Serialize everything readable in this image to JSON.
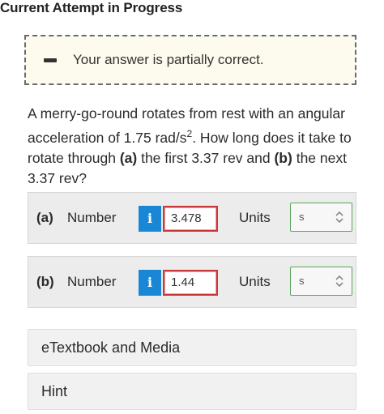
{
  "header": {
    "title": "Current Attempt in Progress"
  },
  "notice": {
    "icon": "minus-icon",
    "message": "Your answer is partially correct."
  },
  "question": {
    "line1": "A merry-go-round rotates from rest with an angular",
    "line2_pre": "acceleration of 1.75 rad/s",
    "line2_sup": "2",
    "line2_post": ". How long does it take to",
    "line3_pre": "rotate through ",
    "line3_a": "(a)",
    "line3_mid": " the first 3.37 rev and ",
    "line3_b": "(b)",
    "line3_post": " the next",
    "line4": "3.37 rev?"
  },
  "answers": [
    {
      "part": "(a)",
      "number_label": "Number",
      "info": "i",
      "value": "3.478",
      "units_label": "Units",
      "unit": "s"
    },
    {
      "part": "(b)",
      "number_label": "Number",
      "info": "i",
      "value": "1.44",
      "units_label": "Units",
      "unit": "s"
    }
  ],
  "accordions": {
    "etextbook": "eTextbook and Media",
    "hint": "Hint"
  },
  "colors": {
    "info_button": "#1a86d6",
    "input_error_border": "#c8383b",
    "select_border": "#5aa55a",
    "notice_bg": "#fdfbee"
  }
}
